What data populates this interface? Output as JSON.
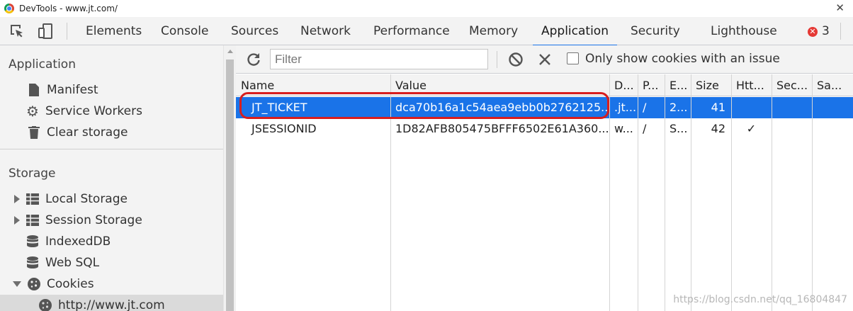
{
  "window": {
    "title": "DevTools - www.jt.com/"
  },
  "tabs": [
    {
      "label": "Elements"
    },
    {
      "label": "Console"
    },
    {
      "label": "Sources"
    },
    {
      "label": "Network"
    },
    {
      "label": "Performance"
    },
    {
      "label": "Memory"
    },
    {
      "label": "Application",
      "active": true
    },
    {
      "label": "Security"
    },
    {
      "label": "Lighthouse"
    }
  ],
  "errors": {
    "count": "3"
  },
  "sidebar": {
    "application_title": "Application",
    "application_items": [
      {
        "label": "Manifest",
        "icon": "document-icon"
      },
      {
        "label": "Service Workers",
        "icon": "gear-icon"
      },
      {
        "label": "Clear storage",
        "icon": "trash-icon"
      }
    ],
    "storage_title": "Storage",
    "storage_items": [
      {
        "label": "Local Storage",
        "icon": "grid-icon",
        "expand": "collapsed"
      },
      {
        "label": "Session Storage",
        "icon": "grid-icon",
        "expand": "collapsed"
      },
      {
        "label": "IndexedDB",
        "icon": "database-icon"
      },
      {
        "label": "Web SQL",
        "icon": "database-icon"
      },
      {
        "label": "Cookies",
        "icon": "cookie-icon",
        "expand": "expanded"
      }
    ],
    "cookie_origin": "http://www.jt.com"
  },
  "toolbar": {
    "filter_placeholder": "Filter",
    "only_issues_label": "Only show cookies with an issue",
    "only_issues_checked": false
  },
  "table": {
    "columns": [
      "Name",
      "Value",
      "D...",
      "P...",
      "E...",
      "Size",
      "Htt...",
      "Sec...",
      "Sa..."
    ],
    "rows": [
      {
        "name": "JT_TICKET",
        "value": "dca70b16a1c54aea9ebb0b2762125...",
        "domain": ".jt...",
        "path": "/",
        "expires": "2...",
        "size": "41",
        "httponly": "",
        "secure": "",
        "samesite": "",
        "selected": true
      },
      {
        "name": "JSESSIONID",
        "value": "1D82AFB805475BFFF6502E61A360...",
        "domain": "w...",
        "path": "/",
        "expires": "S...",
        "size": "42",
        "httponly": "✓",
        "secure": "",
        "samesite": "",
        "selected": false
      }
    ]
  },
  "watermark": "https://blog.csdn.net/qq_16804847",
  "colors": {
    "accent": "#1a73e8",
    "highlight_oval": "#d81e1e",
    "error": "#e53935"
  }
}
